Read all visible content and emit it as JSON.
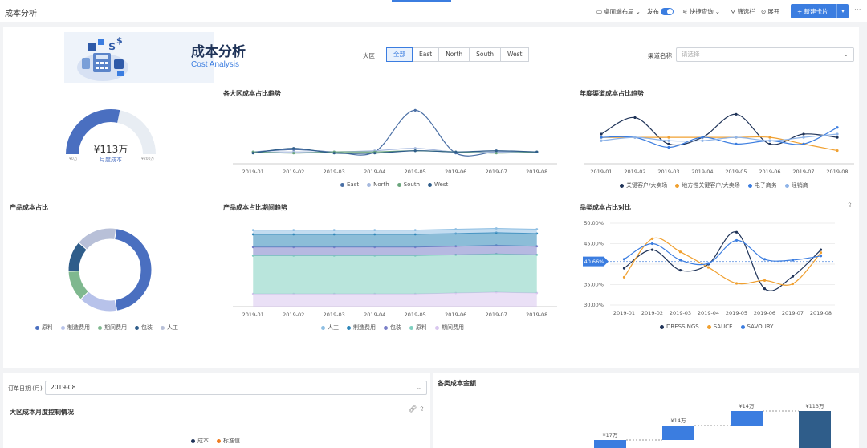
{
  "app": {
    "title": "成本分析"
  },
  "toolbar": {
    "desktop_layout": "桌面端布局",
    "publish": "发布",
    "quick_query": "快捷查询",
    "filter_bar": "筛选栏",
    "expand": "展开",
    "new_card": "+ 新建卡片",
    "more": "···"
  },
  "header": {
    "title": "成本分析",
    "subtitle": "Cost Analysis",
    "region_label": "大区",
    "region_options": [
      "全部",
      "East",
      "North",
      "South",
      "West"
    ],
    "region_selected": "全部",
    "channel_label": "渠道名称",
    "channel_placeholder": "请选择"
  },
  "gauge": {
    "value_text": "¥113万",
    "label": "月度成本",
    "min_label": "¥0万",
    "max_label": "¥200万",
    "fraction": 0.565
  },
  "charts": [
    {
      "id": "region-trend",
      "type": "line",
      "title": "各大区成本占比趋势",
      "categories": [
        "2019-01",
        "2019-02",
        "2019-03",
        "2019-04",
        "2019-05",
        "2019-06",
        "2019-07",
        "2019-08"
      ],
      "series": [
        {
          "name": "East",
          "color": "#4a6fa5",
          "values": [
            0.25,
            0.27,
            0.25,
            0.25,
            0.6,
            0.24,
            0.25,
            0.25
          ]
        },
        {
          "name": "North",
          "color": "#a6b9de",
          "values": [
            0.25,
            0.25,
            0.25,
            0.26,
            0.28,
            0.25,
            0.25,
            0.25
          ]
        },
        {
          "name": "South",
          "color": "#6aa57c",
          "values": [
            0.25,
            0.24,
            0.25,
            0.25,
            0.26,
            0.25,
            0.24,
            0.25
          ]
        },
        {
          "name": "West",
          "color": "#2f5d8a",
          "values": [
            0.24,
            0.28,
            0.24,
            0.24,
            0.26,
            0.25,
            0.26,
            0.25
          ]
        }
      ]
    },
    {
      "id": "channel-trend",
      "type": "line",
      "title": "年度渠道成本占比趋势",
      "categories": [
        "2019-01",
        "2019-02",
        "2019-03",
        "2019-04",
        "2019-05",
        "2019-06",
        "2019-07",
        "2019-08"
      ],
      "series": [
        {
          "name": "关键客户/大卖场",
          "color": "#1f3358",
          "values": [
            0.26,
            0.31,
            0.23,
            0.25,
            0.32,
            0.23,
            0.26,
            0.25
          ]
        },
        {
          "name": "地方性关键客户/大卖场",
          "color": "#f0a030",
          "values": [
            0.25,
            0.25,
            0.25,
            0.25,
            0.25,
            0.25,
            0.23,
            0.21
          ]
        },
        {
          "name": "电子商务",
          "color": "#3b7de0",
          "values": [
            0.25,
            0.25,
            0.22,
            0.25,
            0.23,
            0.24,
            0.23,
            0.28
          ]
        },
        {
          "name": "经销商",
          "color": "#8fb4e8",
          "values": [
            0.24,
            0.25,
            0.24,
            0.24,
            0.25,
            0.24,
            0.25,
            0.26
          ]
        }
      ]
    },
    {
      "id": "product-share",
      "type": "pie",
      "title": "产品成本占比",
      "categories": [
        "原料",
        "制造费用",
        "期间费用",
        "包装",
        "人工"
      ],
      "colors": [
        "#4a6fc0",
        "#b7c2ea",
        "#7fb88f",
        "#2f5d8a",
        "#b8c0d8"
      ],
      "values": [
        45,
        15,
        12,
        12,
        16
      ]
    },
    {
      "id": "product-period-trend",
      "type": "area",
      "title": "产品成本占比期间趋势",
      "categories": [
        "2019-01",
        "2019-02",
        "2019-03",
        "2019-04",
        "2019-05",
        "2019-06",
        "2019-07",
        "2019-08"
      ],
      "series": [
        {
          "name": "人工",
          "color": "#8fbfe3",
          "values": [
            0.05,
            0.05,
            0.05,
            0.05,
            0.05,
            0.05,
            0.05,
            0.05
          ]
        },
        {
          "name": "制造费用",
          "color": "#2e86b8",
          "values": [
            0.15,
            0.15,
            0.15,
            0.15,
            0.15,
            0.15,
            0.15,
            0.15
          ]
        },
        {
          "name": "包装",
          "color": "#7a7fc8",
          "values": [
            0.1,
            0.1,
            0.1,
            0.1,
            0.1,
            0.1,
            0.1,
            0.1
          ]
        },
        {
          "name": "原料",
          "color": "#7fd0c0",
          "values": [
            0.45,
            0.45,
            0.45,
            0.45,
            0.45,
            0.45,
            0.45,
            0.45
          ]
        },
        {
          "name": "期间费用",
          "color": "#d9c7ef",
          "values": [
            0.15,
            0.15,
            0.15,
            0.15,
            0.15,
            0.16,
            0.17,
            0.16
          ]
        }
      ]
    },
    {
      "id": "category-cost-compare",
      "type": "line",
      "title": "品类成本占比对比",
      "categories": [
        "2019-01",
        "2019-02",
        "2019-03",
        "2019-04",
        "2019-05",
        "2019-06",
        "2019-07",
        "2019-08"
      ],
      "ylim": [
        30,
        50
      ],
      "yticks": [
        "30.00%",
        "35.00%",
        "40.00%",
        "45.00%",
        "50.00%"
      ],
      "reference": {
        "label": "40.66%",
        "value": 40.66
      },
      "series": [
        {
          "name": "DRESSINGS",
          "color": "#1f3358",
          "values": [
            39.0,
            43.5,
            38.5,
            40.0,
            47.8,
            34.0,
            37.0,
            43.5
          ]
        },
        {
          "name": "SAUCE",
          "color": "#f0a030",
          "values": [
            36.8,
            46.2,
            43.0,
            39.2,
            35.3,
            36.0,
            35.2,
            42.8
          ]
        },
        {
          "name": "SAVOURY",
          "color": "#3b7de0",
          "values": [
            41.2,
            45.0,
            41.0,
            40.2,
            45.8,
            41.2,
            41.0,
            42.0
          ]
        }
      ]
    },
    {
      "id": "region-monthly-control",
      "type": "line",
      "title": "大区成本月度控制情况",
      "series": [
        {
          "name": "成本",
          "color": "#1f3358"
        },
        {
          "name": "标准值",
          "color": "#f07d20"
        }
      ]
    },
    {
      "id": "category-cost-amount",
      "type": "bar",
      "title": "各类成本金额",
      "data_labels": [
        "¥17万",
        "¥14万",
        "¥14万",
        "¥113万"
      ],
      "values": [
        17,
        14,
        14,
        113
      ]
    }
  ],
  "filter": {
    "order_date_label": "订单日期 (月)",
    "order_date_value": "2019-08"
  }
}
